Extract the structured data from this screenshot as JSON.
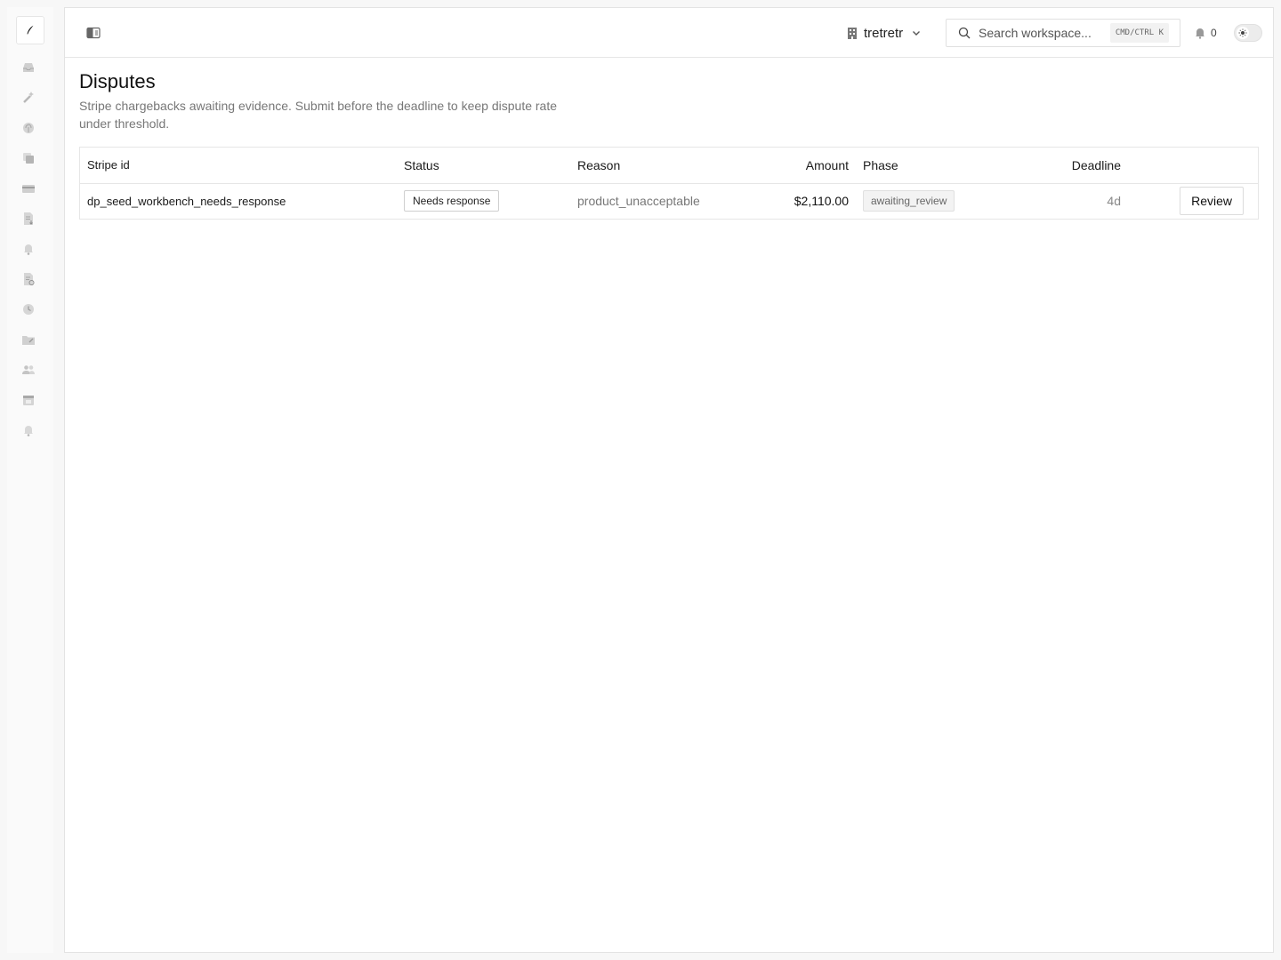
{
  "sidebar": {
    "items": [
      {
        "icon": "inbox-icon"
      },
      {
        "icon": "wand-icon"
      },
      {
        "icon": "fingerprint-icon"
      },
      {
        "icon": "copy-icon"
      },
      {
        "icon": "credit-card-icon"
      },
      {
        "icon": "document-download-icon"
      },
      {
        "icon": "bell-icon"
      },
      {
        "icon": "document-refresh-icon"
      },
      {
        "icon": "clock-icon"
      },
      {
        "icon": "folder-icon"
      },
      {
        "icon": "users-icon"
      },
      {
        "icon": "calendar-icon"
      },
      {
        "icon": "bell-icon"
      }
    ]
  },
  "header": {
    "workspace_name": "tretretr",
    "search_placeholder": "Search workspace...",
    "search_shortcut": "CMD/CTRL K",
    "notification_count": "0"
  },
  "page": {
    "title": "Disputes",
    "description": "Stripe chargebacks awaiting evidence. Submit before the deadline to keep dispute rate under threshold."
  },
  "table": {
    "columns": {
      "stripe_id": "Stripe id",
      "status": "Status",
      "reason": "Reason",
      "amount": "Amount",
      "phase": "Phase",
      "deadline": "Deadline"
    },
    "rows": [
      {
        "stripe_id": "dp_seed_workbench_needs_response",
        "status": "Needs response",
        "reason": "product_unacceptable",
        "amount": "$2,110.00",
        "phase": "awaiting_review",
        "deadline": "4d",
        "action": "Review"
      }
    ]
  },
  "colors": {
    "background": "#f7f7f7",
    "surface": "#ffffff",
    "border": "#e6e6e6",
    "muted_text": "#777777"
  }
}
